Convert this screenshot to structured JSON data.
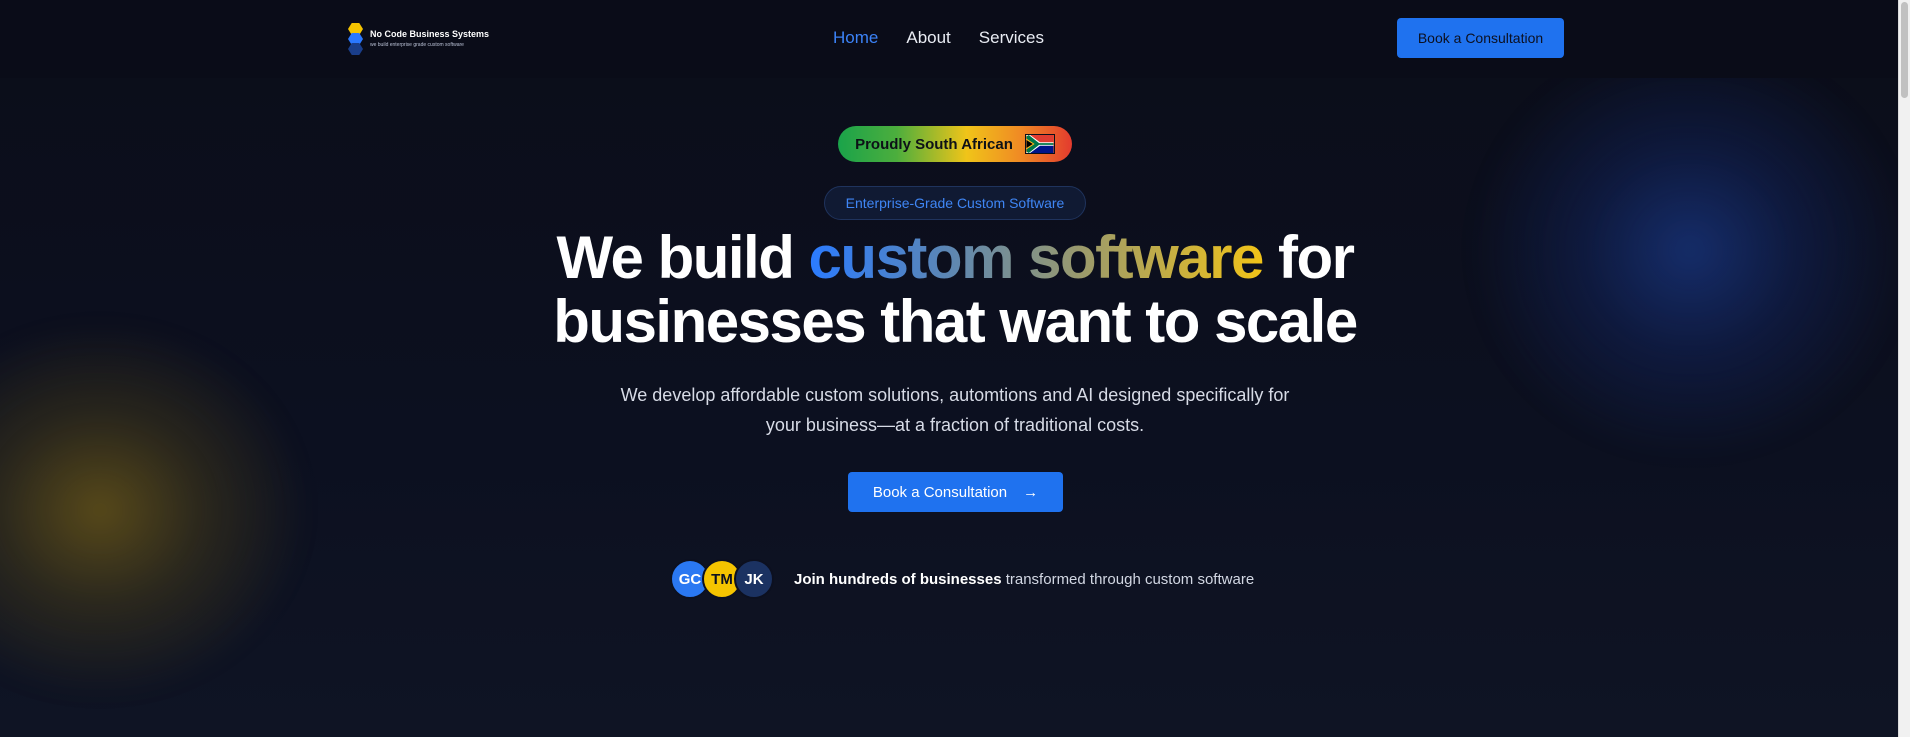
{
  "brand": {
    "name": "No Code Business Systems",
    "tagline": "we build enterprise grade custom software"
  },
  "nav": {
    "items": [
      {
        "label": "Home",
        "active": true
      },
      {
        "label": "About",
        "active": false
      },
      {
        "label": "Services",
        "active": false
      }
    ],
    "cta_label": "Book a Consultation"
  },
  "hero": {
    "pill_label": "Proudly South African",
    "pill_flag_icon": "south-africa-flag-icon",
    "badge_label": "Enterprise-Grade Custom Software",
    "headline_start": "We build ",
    "headline_highlight": "custom software",
    "headline_end": " for businesses that want to scale",
    "subheadline": "We develop affordable custom solutions, automtions and AI designed specifically for your business—at a fraction of traditional costs.",
    "cta_label": "Book a Consultation",
    "cta_icon": "arrow-right-icon"
  },
  "social_proof": {
    "avatars": [
      "GC",
      "TM",
      "JK"
    ],
    "text_bold": "Join hundreds of businesses",
    "text_rest": " transformed through custom software"
  },
  "colors": {
    "background": "#0b0e1b",
    "accent_blue": "#1f72ef",
    "accent_yellow": "#f5c400",
    "nav_active": "#3b82f6"
  }
}
